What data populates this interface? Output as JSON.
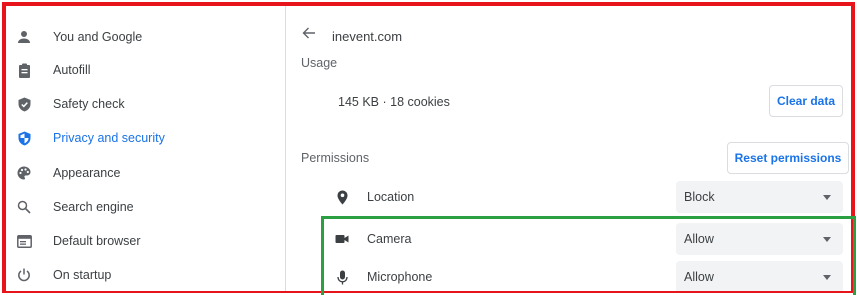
{
  "sidebar": {
    "items": [
      {
        "label": "You and Google",
        "icon": "person-icon"
      },
      {
        "label": "Autofill",
        "icon": "clipboard-icon"
      },
      {
        "label": "Safety check",
        "icon": "shield-check-icon"
      },
      {
        "label": "Privacy and security",
        "icon": "shield-icon",
        "active": true
      },
      {
        "label": "Appearance",
        "icon": "palette-icon"
      },
      {
        "label": "Search engine",
        "icon": "search-icon"
      },
      {
        "label": "Default browser",
        "icon": "browser-icon"
      },
      {
        "label": "On startup",
        "icon": "power-icon"
      }
    ]
  },
  "main": {
    "site": "inevent.com",
    "usage": {
      "heading": "Usage",
      "summary": "145 KB · 18 cookies",
      "clear_button": "Clear data"
    },
    "permissions": {
      "heading": "Permissions",
      "reset_button": "Reset permissions",
      "rows": [
        {
          "label": "Location",
          "value": "Block",
          "icon": "location-pin-icon"
        },
        {
          "label": "Camera",
          "value": "Allow",
          "icon": "camera-icon"
        },
        {
          "label": "Microphone",
          "value": "Allow",
          "icon": "microphone-icon"
        }
      ]
    }
  },
  "colors": {
    "accent": "#1a73e8",
    "highlight_red": "#e8141b",
    "highlight_green": "#2aa043"
  }
}
